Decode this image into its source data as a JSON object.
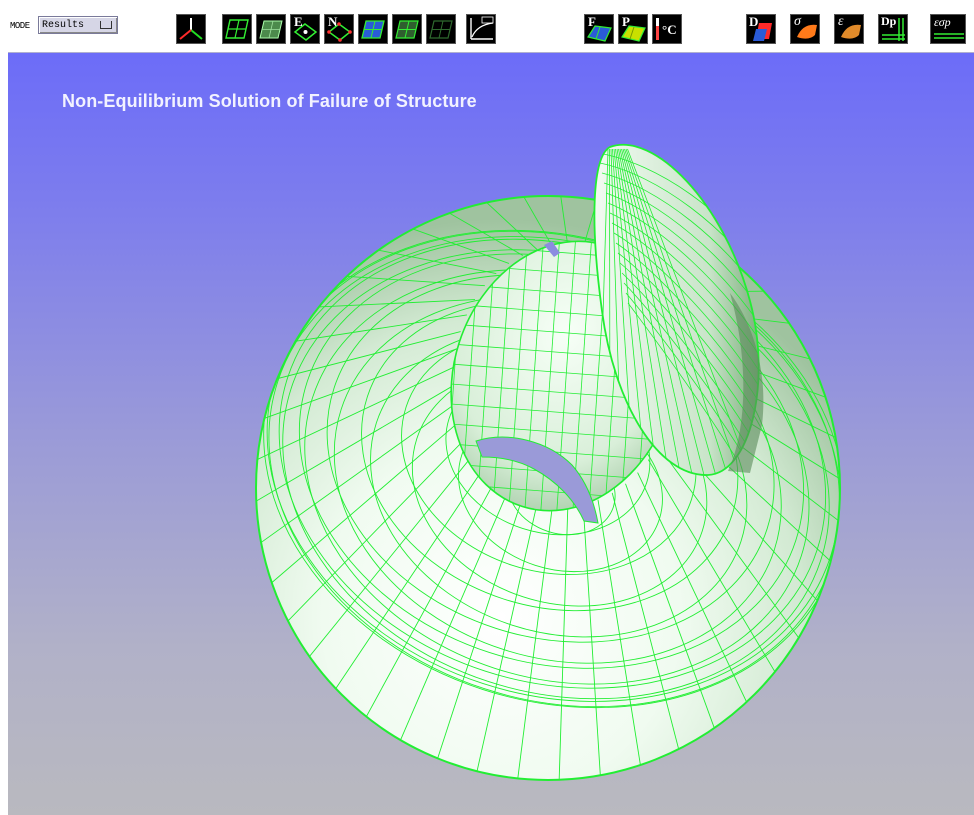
{
  "toolbar": {
    "mode_label": "MODE",
    "mode_value": "Results",
    "tools": [
      {
        "name": "axes-icon",
        "letter": ""
      },
      {
        "name": "wireframe-mesh-icon",
        "letter": ""
      },
      {
        "name": "shaded-surface-icon",
        "letter": ""
      },
      {
        "name": "element-numbers-icon",
        "letter": "E"
      },
      {
        "name": "node-numbers-icon",
        "letter": "N"
      },
      {
        "name": "mesh-display-icon",
        "letter": ""
      },
      {
        "name": "hidden-mesh-icon",
        "letter": ""
      },
      {
        "name": "graph-plot-icon",
        "letter": ""
      },
      {
        "name": "force-display-icon",
        "letter": "F"
      },
      {
        "name": "pressure-display-icon",
        "letter": "P"
      },
      {
        "name": "temperature-display-icon",
        "letter": "°C"
      },
      {
        "name": "displacement-display-icon",
        "letter": "D"
      },
      {
        "name": "stress-display-icon",
        "letter": "σ"
      },
      {
        "name": "strain-display-icon",
        "letter": "ε"
      },
      {
        "name": "plastic-displacement-icon",
        "letter": "Dp"
      },
      {
        "name": "plastic-strain-icon",
        "letter": "εσp"
      }
    ]
  },
  "viewport": {
    "title": "Non-Equilibrium Solution of Failure of Structure"
  },
  "colors": {
    "mesh": "#22ee33",
    "background_top": "#6c6cf8",
    "background_bottom": "#b9b9bf"
  }
}
